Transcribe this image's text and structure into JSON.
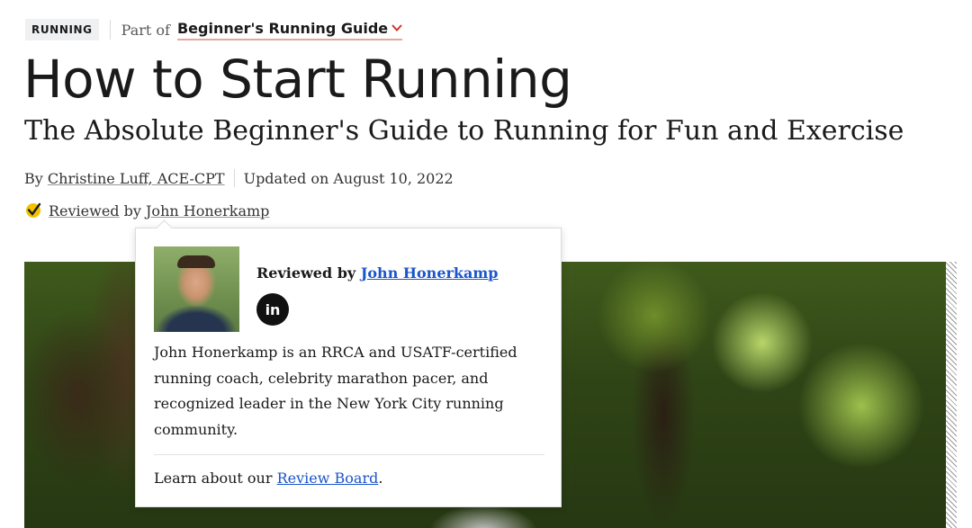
{
  "header": {
    "category_tag": "RUNNING",
    "part_of_label": "Part of",
    "guide_link": "Beginner's Running Guide"
  },
  "article": {
    "title": "How to Start Running",
    "subtitle": "The Absolute Beginner's Guide to Running for Fun and Exercise"
  },
  "byline": {
    "by_label": "By",
    "author": "Christine Luff, ACE-CPT",
    "updated": "Updated on August 10, 2022"
  },
  "review": {
    "reviewed_link": "Reviewed",
    "by_label": "by",
    "reviewer": "John Honerkamp"
  },
  "popover": {
    "reviewed_by_label": "Reviewed by",
    "reviewer": "John Honerkamp",
    "social_icon": "in",
    "bio": "John Honerkamp is an RRCA and USATF-certified running coach, celebrity marathon pacer, and recognized leader in the New York City running community.",
    "learn_prefix": "Learn about our",
    "review_board_link": "Review Board",
    "learn_suffix": "."
  },
  "colors": {
    "accent_link": "#1a55c9",
    "guide_underline": "#e8a59a",
    "chevron": "#d0342c",
    "check_badge": "#f2c200"
  }
}
